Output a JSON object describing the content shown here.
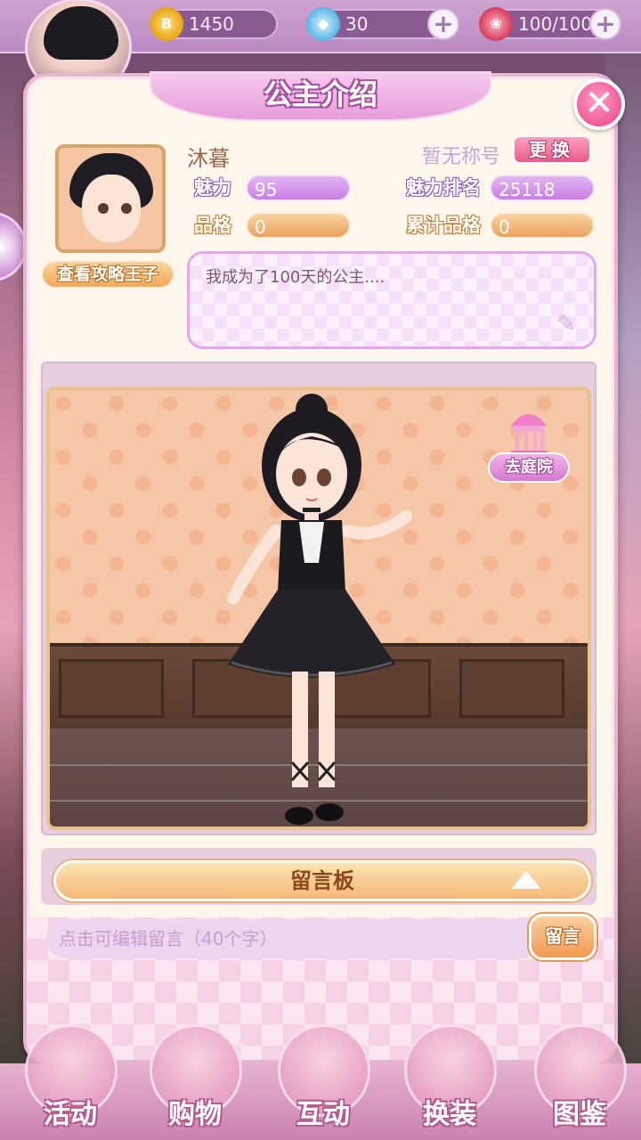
{
  "resources": {
    "gold": {
      "value": "1450",
      "icon": "gold-coin-icon"
    },
    "diamond": {
      "value": "30",
      "icon": "diamond-icon"
    },
    "rose": {
      "value": "100/100",
      "icon": "rose-icon"
    },
    "plus": "+"
  },
  "dialog": {
    "title": "公主介绍",
    "close_icon": "✕"
  },
  "profile": {
    "name": "沐暮",
    "title_status": "暂无称号",
    "change_button": "更换",
    "strategy_button": "查看攻略王子",
    "bio": "我成为了100天的公主....",
    "stats": {
      "charm_label": "魅力",
      "charm_value": "95",
      "charm_rank_label": "魅力排名",
      "charm_rank_value": "25118",
      "character_label": "品格",
      "character_value": "0",
      "total_character_label": "累计品格",
      "total_character_value": "0"
    }
  },
  "scene": {
    "garden_button": "去庭院"
  },
  "message_board": {
    "title": "留言板",
    "input_placeholder": "点击可编辑留言（40个字）",
    "submit_button": "留言"
  },
  "bottom_nav": [
    {
      "label": "活动"
    },
    {
      "label": "购物"
    },
    {
      "label": "互动"
    },
    {
      "label": "换装"
    },
    {
      "label": "图鉴"
    }
  ],
  "colors": {
    "accent_pink": "#e75b8c",
    "purple_bar": "#c97fe3",
    "orange_bar": "#eba25c"
  }
}
